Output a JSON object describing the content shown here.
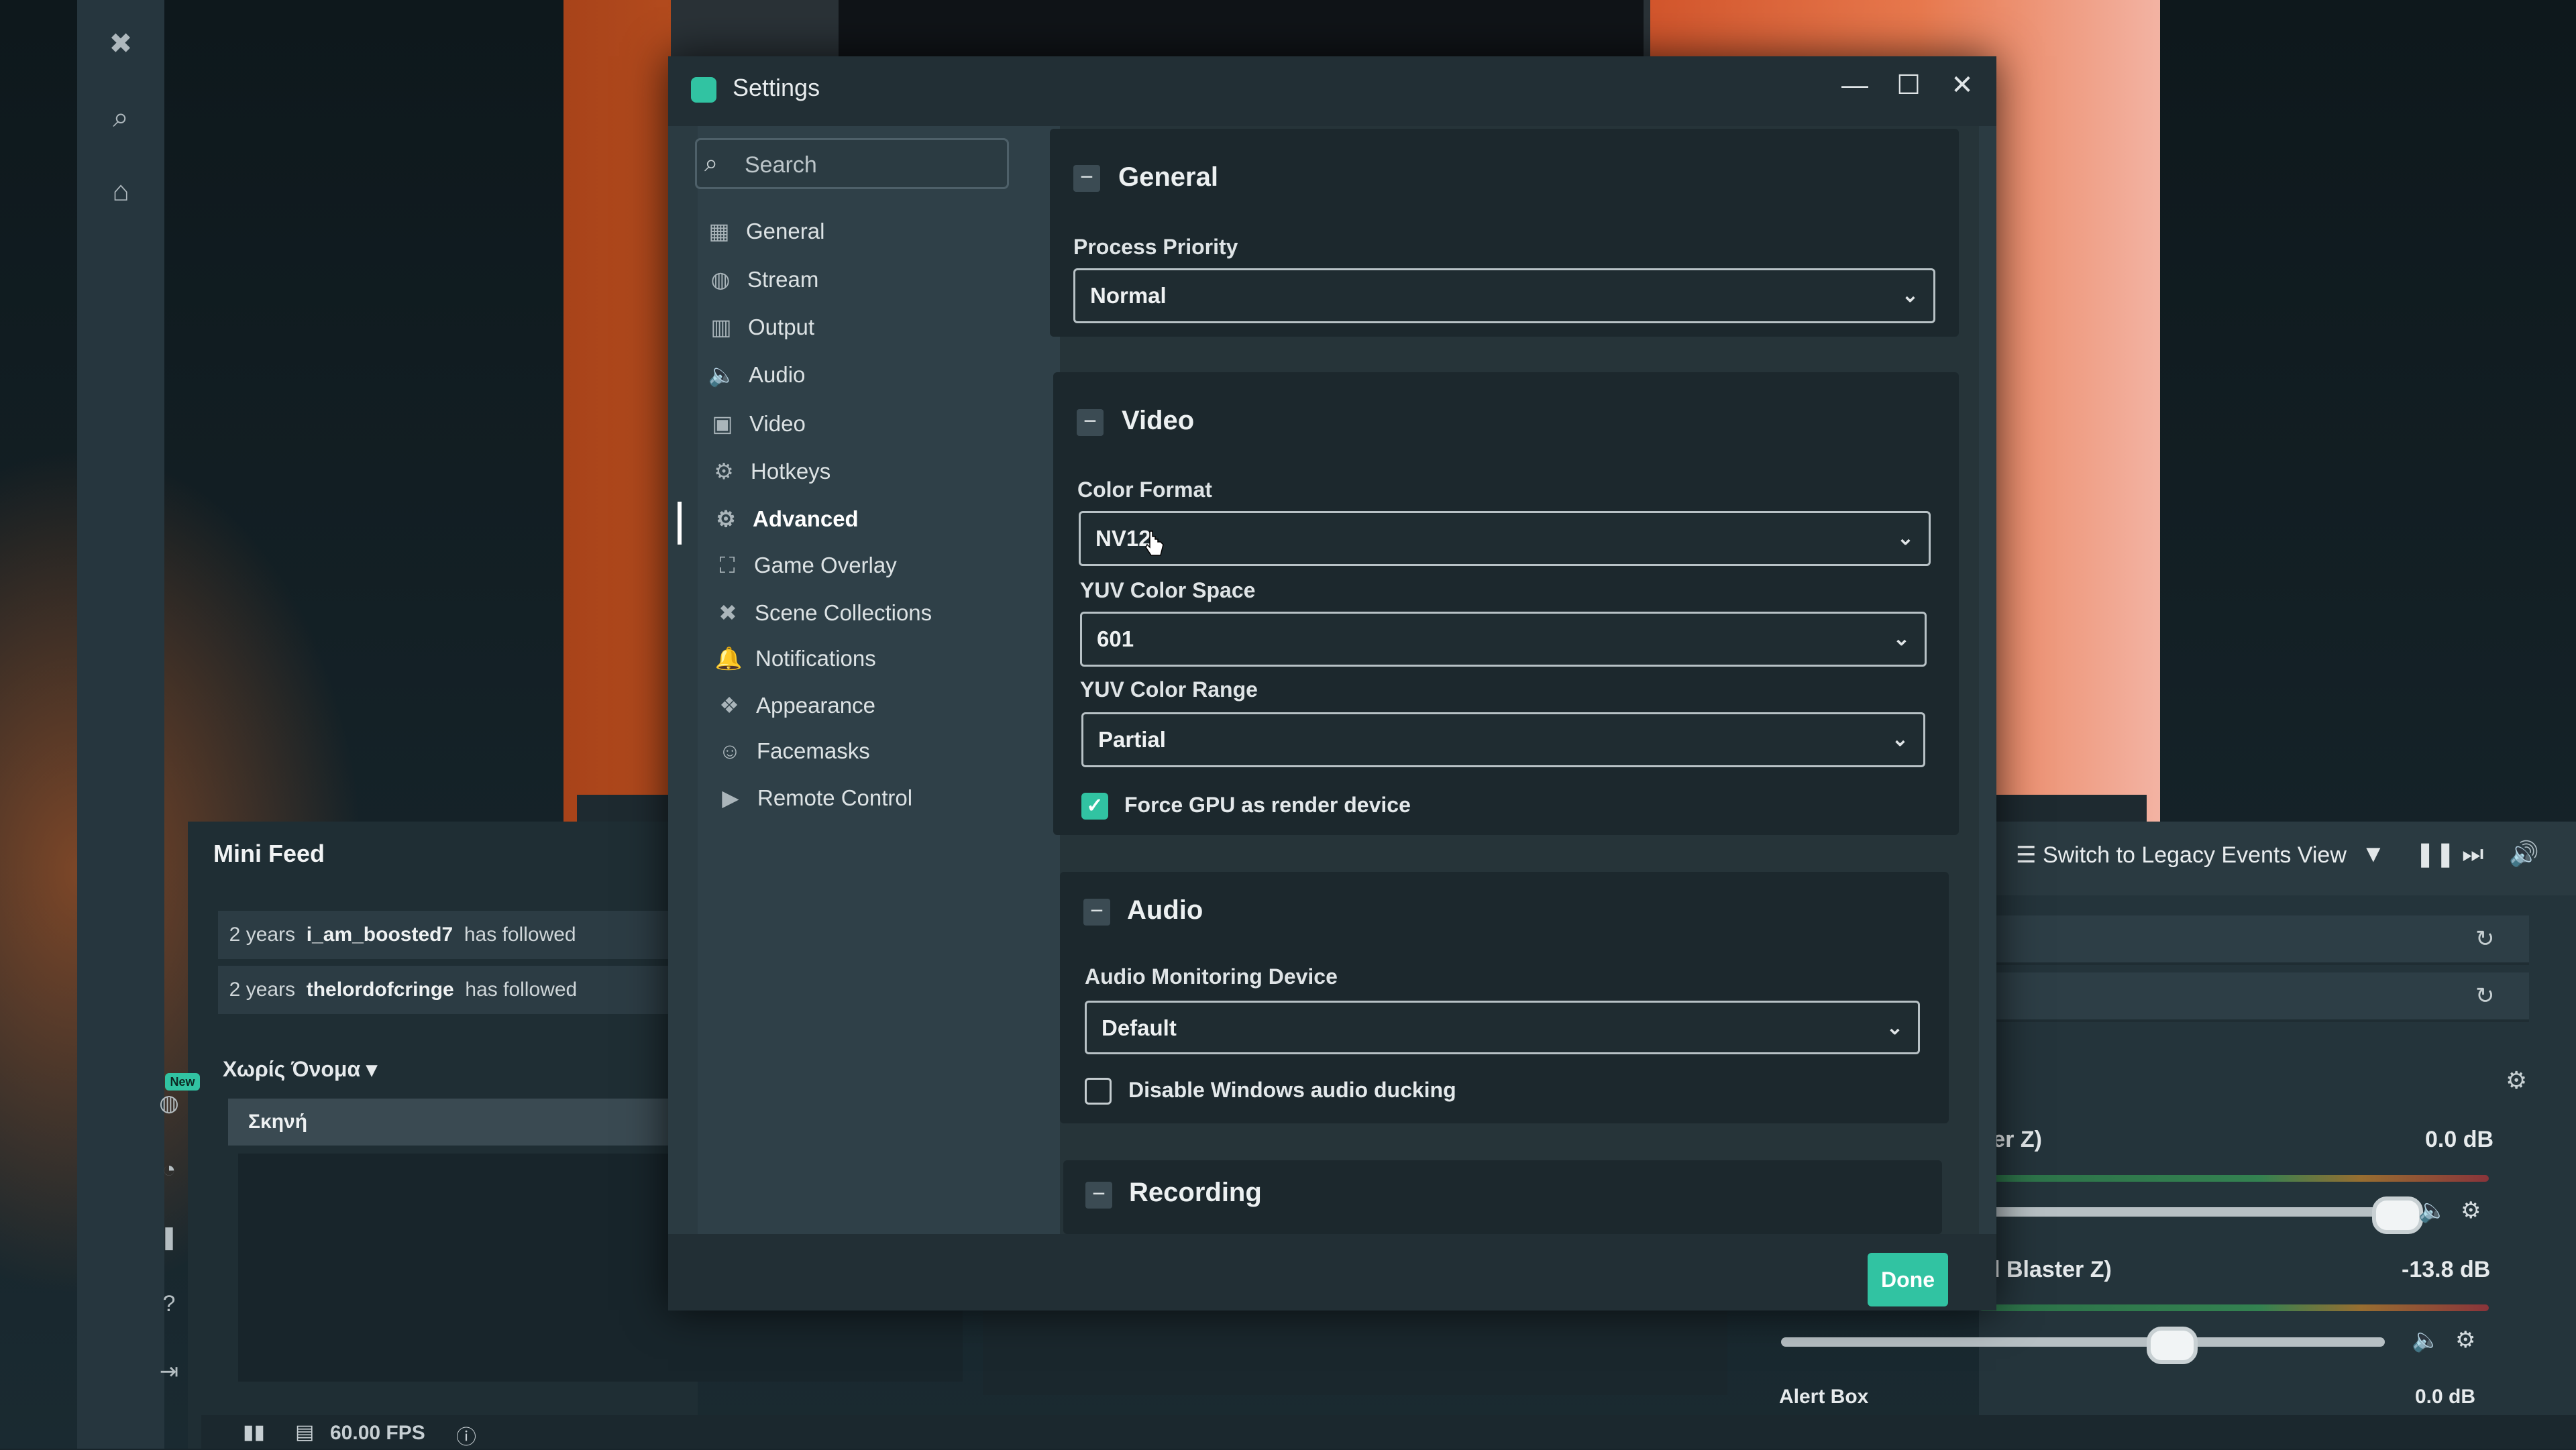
{
  "window": {
    "title": "Settings"
  },
  "search": {
    "placeholder": "Search"
  },
  "sidebar": {
    "items": [
      {
        "label": "General",
        "icon": "grid-icon"
      },
      {
        "label": "Stream",
        "icon": "globe-icon"
      },
      {
        "label": "Output",
        "icon": "output-icon"
      },
      {
        "label": "Audio",
        "icon": "speaker-icon"
      },
      {
        "label": "Video",
        "icon": "film-icon"
      },
      {
        "label": "Hotkeys",
        "icon": "gear-icon"
      },
      {
        "label": "Advanced",
        "icon": "gears-icon",
        "active": true
      },
      {
        "label": "Game Overlay",
        "icon": "overlay-icon"
      },
      {
        "label": "Scene Collections",
        "icon": "collections-icon"
      },
      {
        "label": "Notifications",
        "icon": "bell-icon"
      },
      {
        "label": "Appearance",
        "icon": "appearance-icon"
      },
      {
        "label": "Facemasks",
        "icon": "mask-icon"
      },
      {
        "label": "Remote Control",
        "icon": "play-circle-icon"
      }
    ]
  },
  "general": {
    "title": "General",
    "process_priority_label": "Process Priority",
    "process_priority_value": "Normal"
  },
  "video": {
    "title": "Video",
    "color_format_label": "Color Format",
    "color_format_value": "NV12",
    "yuv_space_label": "YUV Color Space",
    "yuv_space_value": "601",
    "yuv_range_label": "YUV Color Range",
    "yuv_range_value": "Partial",
    "force_gpu_label": "Force GPU as render device",
    "force_gpu_checked": true
  },
  "audio": {
    "title": "Audio",
    "monitoring_label": "Audio Monitoring Device",
    "monitoring_value": "Default",
    "ducking_label": "Disable Windows audio ducking",
    "ducking_checked": false
  },
  "recording": {
    "title": "Recording"
  },
  "footer": {
    "done_label": "Done"
  },
  "mini_feed": {
    "title": "Mini Feed",
    "rows": [
      {
        "age": "2 years",
        "user": "i_am_boosted7",
        "action": "has followed"
      },
      {
        "age": "2 years",
        "user": "thelordofcringe",
        "action": "has followed"
      }
    ]
  },
  "scenes": {
    "collection": "Χωρίς Όνομα",
    "item": "Σκηνή",
    "new_badge": "New"
  },
  "events": {
    "legacy_label": "Switch to Legacy Events View"
  },
  "mixer": {
    "rows": [
      {
        "name": "ster Z)",
        "level": "0.0 dB"
      },
      {
        "name": "nd Blaster Z)",
        "level": "-13.8 dB"
      },
      {
        "name": "Alert Box",
        "level": "0.0 dB"
      }
    ]
  },
  "status": {
    "fps": "60.00 FPS"
  },
  "colors": {
    "accent": "#31c3a2",
    "panel": "#263439",
    "window": "#2b3b42"
  }
}
